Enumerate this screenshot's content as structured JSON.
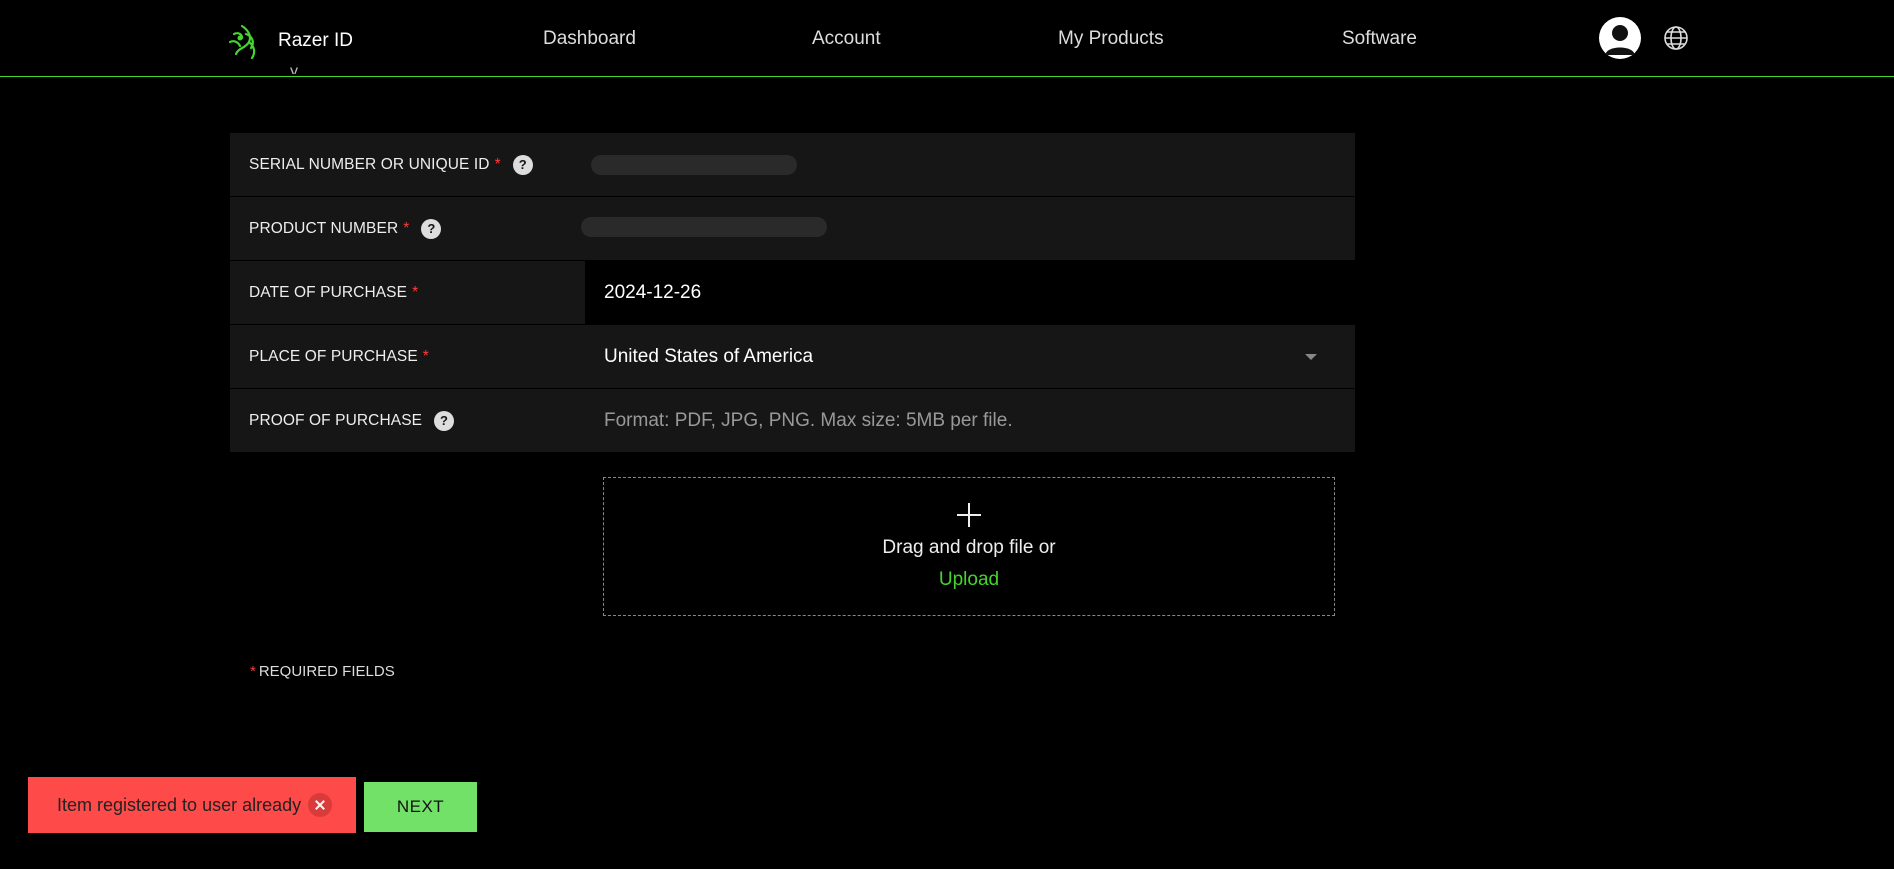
{
  "header": {
    "brand_name": "Razer ID",
    "nav": {
      "dashboard": "Dashboard",
      "account": "Account",
      "my_products": "My Products",
      "software": "Software"
    }
  },
  "form": {
    "fields": {
      "serial": {
        "label": "SERIAL NUMBER OR UNIQUE ID",
        "required_mark": "*",
        "help": "?"
      },
      "product_number": {
        "label": "PRODUCT NUMBER",
        "required_mark": "*",
        "help": "?"
      },
      "date": {
        "label": "DATE OF PURCHASE",
        "required_mark": "*",
        "value": "2024-12-26"
      },
      "place": {
        "label": "PLACE OF PURCHASE",
        "required_mark": "*",
        "value": "United States of America"
      },
      "proof": {
        "label": "PROOF OF PURCHASE",
        "help": "?",
        "hint": "Format: PDF, JPG, PNG. Max size: 5MB per file."
      }
    },
    "upload": {
      "text": "Drag and drop file or",
      "link": "Upload"
    },
    "required_note": {
      "mark": "*",
      "text": "REQUIRED FIELDS"
    }
  },
  "toast": {
    "message": "Item registered to user already"
  },
  "actions": {
    "next_label": "NEXT"
  },
  "colors": {
    "accent": "#44d62c",
    "error": "#ff4a4a",
    "button": "#72e168"
  },
  "icons": [
    "razer-logo-icon",
    "user-avatar-icon",
    "globe-icon",
    "help-icon",
    "chevron-down-icon",
    "plus-icon",
    "close-icon"
  ]
}
